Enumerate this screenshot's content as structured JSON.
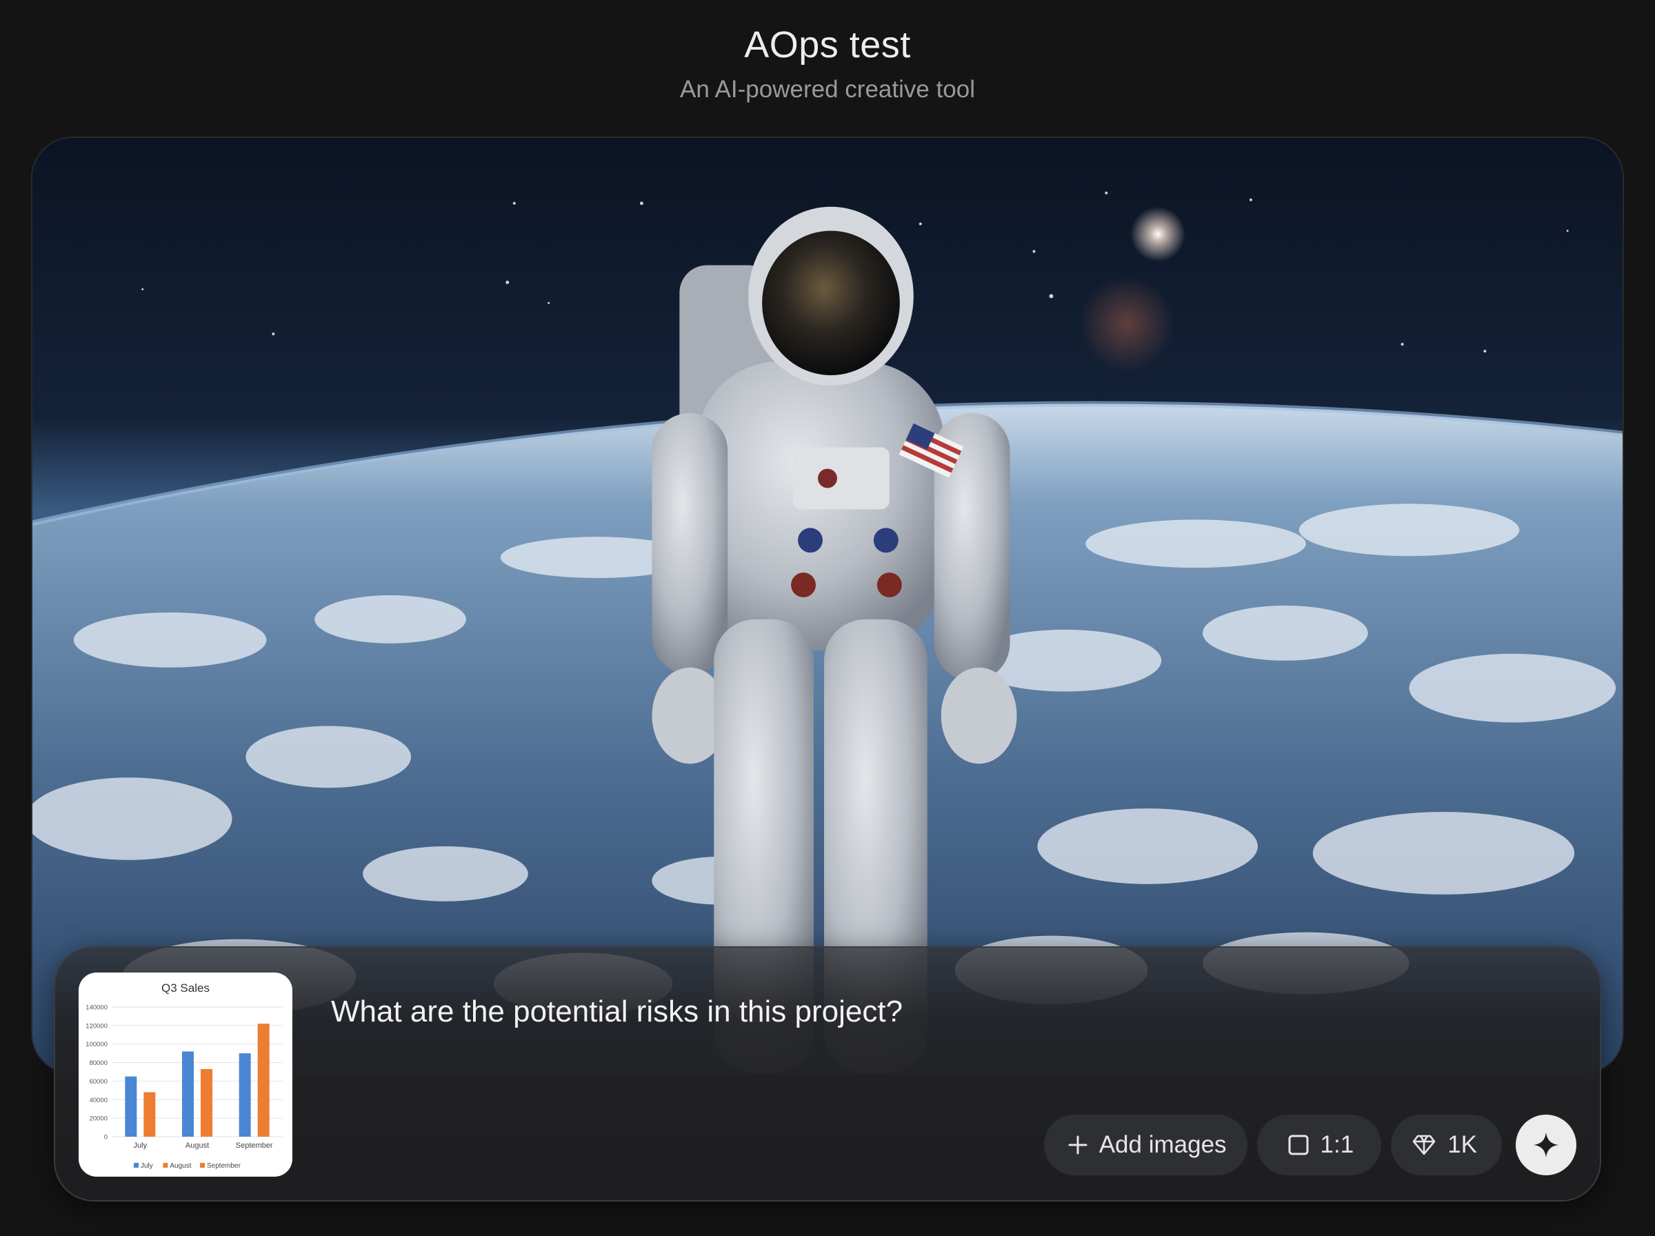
{
  "header": {
    "title": "AOps test",
    "subtitle": "An AI-powered creative tool"
  },
  "hero": {
    "description_icon": "astronaut-over-earth-image"
  },
  "prompt": {
    "text": "What are the potential risks in this project?"
  },
  "attachment": {
    "icon": "chart-thumbnail",
    "chart_data": {
      "type": "bar",
      "title": "Q3 Sales",
      "categories": [
        "July",
        "August",
        "September"
      ],
      "series": [
        {
          "name": "July",
          "values": [
            65000,
            92000,
            90000
          ],
          "color": "#4a86d4"
        },
        {
          "name": "August",
          "values": [
            48000,
            73000,
            122000
          ],
          "color": "#ed7d31"
        }
      ],
      "legend": [
        "July",
        "August",
        "September"
      ],
      "legend_colors": [
        "#4a86d4",
        "#ed7d31",
        "#ed7d31"
      ],
      "yticks": [
        "0",
        "20000",
        "40000",
        "60000",
        "80000",
        "100000",
        "120000",
        "140000"
      ],
      "ylim": [
        0,
        140000
      ],
      "legend_position": "bottom",
      "grid": true
    }
  },
  "controls": {
    "add_images_label": "Add images",
    "aspect_ratio_label": "1:1",
    "quality_label": "1K",
    "add_icon": "plus-icon",
    "ratio_icon": "square-icon",
    "quality_icon": "diamond-icon",
    "send_icon": "sparkle-icon"
  },
  "colors": {
    "background": "#141414",
    "panel": "#232427",
    "pill": "#2e2f32",
    "send_button": "#ececec"
  }
}
